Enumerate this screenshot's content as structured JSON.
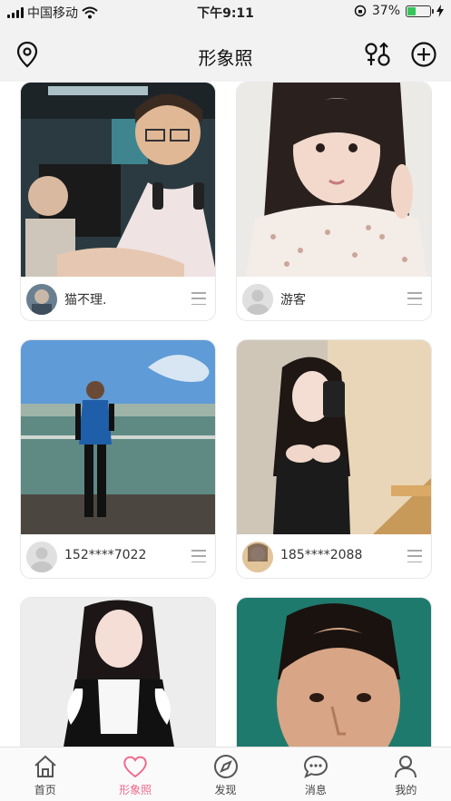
{
  "status_bar": {
    "carrier": "中国移动",
    "time": "下午9:11",
    "battery": "37%",
    "battery_level": 0.37
  },
  "header": {
    "title": "形象照",
    "icons": [
      "location-pin-icon",
      "gender-filter-icon",
      "add-circle-icon"
    ]
  },
  "cards": [
    {
      "username": "猫不理.",
      "avatar": "photo",
      "photo": "man-headphones-gaming"
    },
    {
      "username": "游客",
      "avatar": "default",
      "photo": "girl-floral-shirt"
    },
    {
      "username": "152****7022",
      "avatar": "default",
      "photo": "man-pier-sea"
    },
    {
      "username": "185****2088",
      "avatar": "photo",
      "photo": "woman-mirror-selfie"
    },
    {
      "username": "",
      "avatar": "",
      "photo": "woman-maid-outfit"
    },
    {
      "username": "",
      "avatar": "",
      "photo": "man-closeup"
    }
  ],
  "tabbar": {
    "tabs": [
      {
        "label": "首页",
        "icon": "home-icon"
      },
      {
        "label": "形象照",
        "icon": "heart-icon"
      },
      {
        "label": "发现",
        "icon": "compass-icon"
      },
      {
        "label": "消息",
        "icon": "chat-icon"
      },
      {
        "label": "我的",
        "icon": "profile-icon"
      }
    ],
    "active_index": 1,
    "active_color": "#f06a8c"
  }
}
